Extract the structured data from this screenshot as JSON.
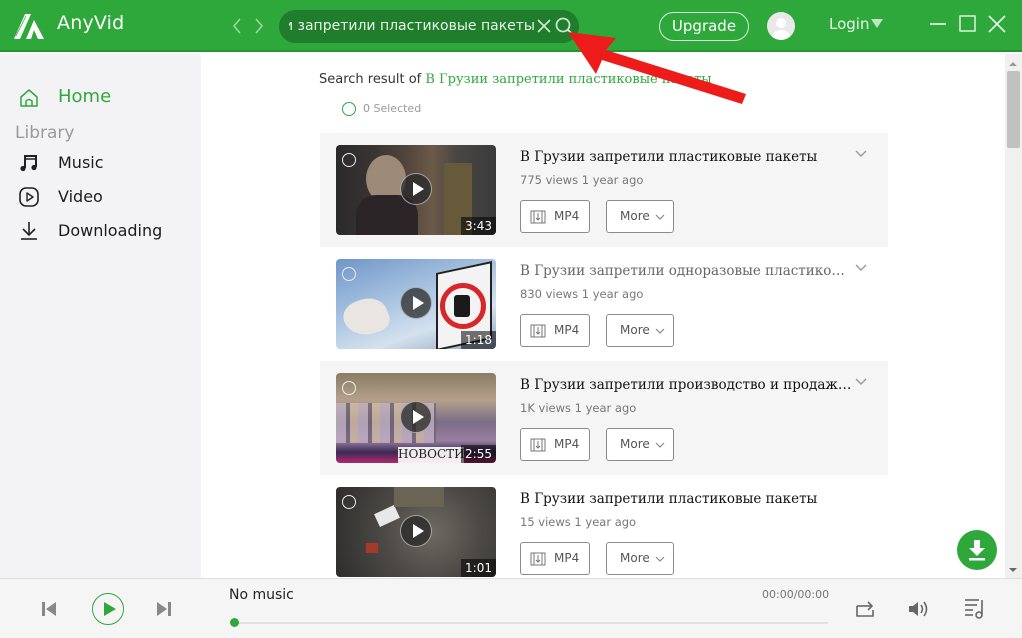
{
  "app": {
    "name": "AnyVid",
    "brand_color": "#2ea83b"
  },
  "titlebar": {
    "back_icon": "chevron-left-icon",
    "forward_icon": "chevron-right-icon",
    "search_value": "В Грузии запретили пластиковые пакеты",
    "search_visible_text": "ли запретили пластиковые пакеты",
    "upgrade_label": "Upgrade",
    "login_label": "Login"
  },
  "sidebar": {
    "home_label": "Home",
    "library_label": "Library",
    "items": [
      {
        "label": "Music",
        "icon": "music-note-icon"
      },
      {
        "label": "Video",
        "icon": "video-play-icon"
      },
      {
        "label": "Downloading",
        "icon": "download-icon"
      }
    ]
  },
  "main": {
    "search_result_prefix": "Search result of ",
    "search_query": "В Грузии запретили пластиковые пакеты",
    "selected_text": "0 Selected",
    "results": [
      {
        "title": "В Грузии запретили пластиковые пакеты",
        "meta": "775 views  1 year ago",
        "duration": "3:43",
        "format_label": "MP4",
        "more_label": "More"
      },
      {
        "title": "В Грузии запретили одноразовые пластиковые...",
        "meta": "830 views  1 year ago",
        "duration": "1:18",
        "format_label": "MP4",
        "more_label": "More"
      },
      {
        "title": "В Грузии запретили производство и продажу ...",
        "meta": "1K views  1 year ago",
        "duration": "2:55",
        "thumb_overlay_text": "НОВОСТИ",
        "format_label": "MP4",
        "more_label": "More"
      },
      {
        "title": "В Грузии запретили пластиковые пакеты",
        "meta": "15 views  1 year ago",
        "duration": "1:01",
        "format_label": "MP4",
        "more_label": "More"
      }
    ]
  },
  "player": {
    "now_playing": "No music",
    "time": "00:00/00:00",
    "progress": 0
  }
}
